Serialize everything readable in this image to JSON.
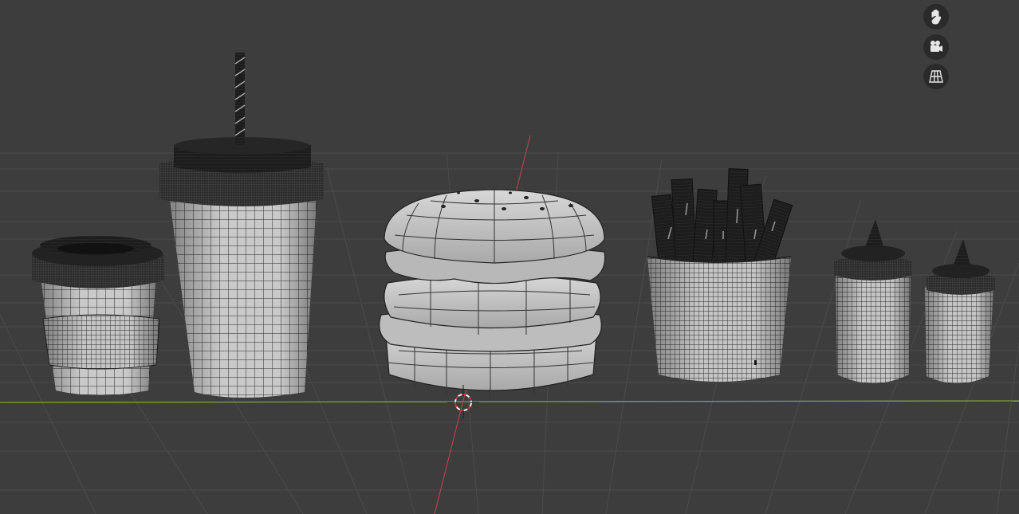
{
  "viewport": {
    "mode": "3d-viewport",
    "shading": "solid-wireframe-overlay",
    "background": "#3d3d3d",
    "grid_color": "#4d4d4d",
    "x_axis_color": "#7fa33a",
    "y_axis_color": "#b8454f",
    "object_color": "#c8c8c8",
    "dark_part_color": "#1c1c1c"
  },
  "navigation": {
    "buttons": [
      {
        "name": "pan-view",
        "icon": "hand-icon"
      },
      {
        "name": "camera-view",
        "icon": "camera-icon"
      },
      {
        "name": "ortho-persp-toggle",
        "icon": "grid-icon"
      }
    ]
  },
  "scene": {
    "objects": [
      "coffee-cup",
      "soda-cup",
      "burger",
      "fries",
      "sauce-bottle-large",
      "sauce-bottle-small"
    ]
  }
}
